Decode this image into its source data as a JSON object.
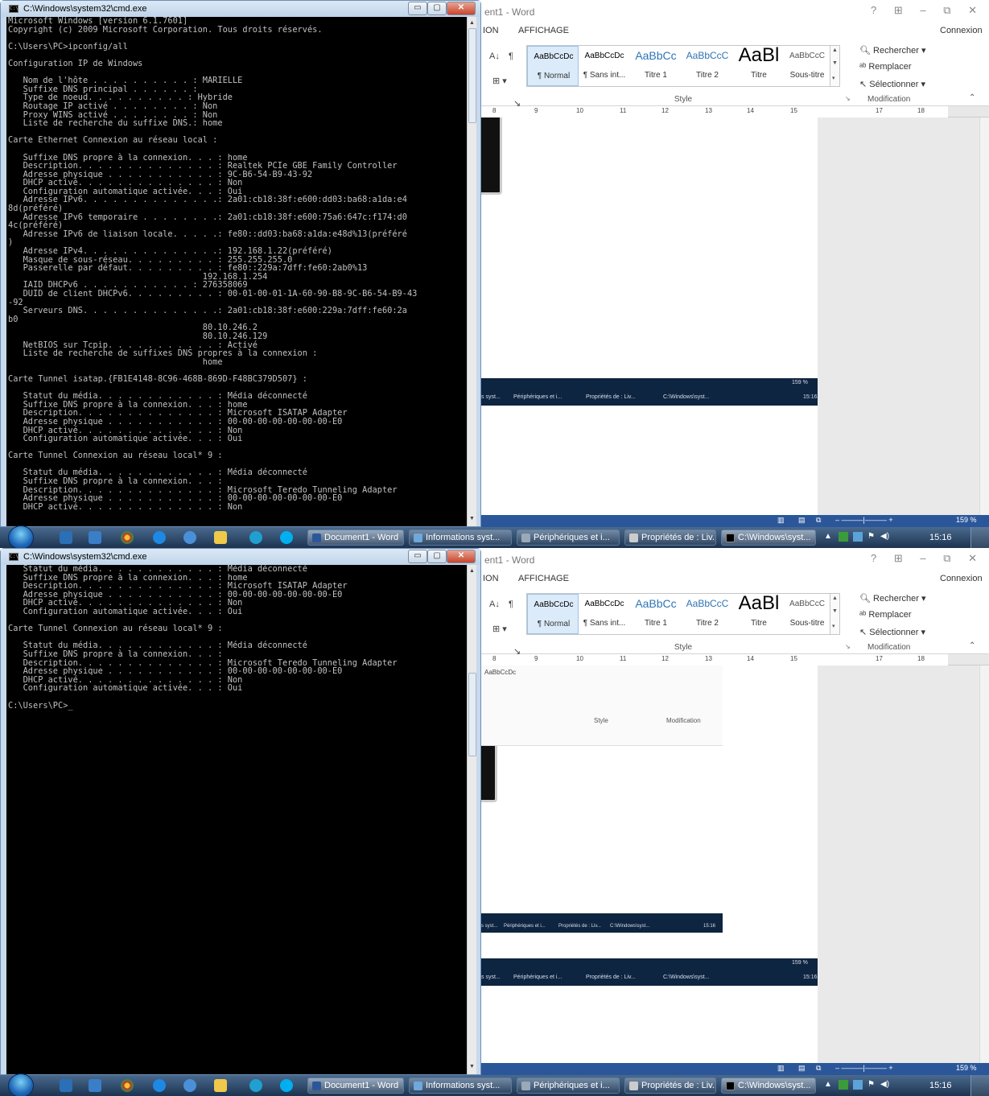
{
  "cmd": {
    "title": "C:\\Windows\\system32\\cmd.exe",
    "icon_label": "C:\\",
    "buttons": {
      "minimize": "▭",
      "maximize": "▢",
      "close": "✕"
    },
    "top_text": "Microsoft Windows [version 6.1.7601]\nCopyright (c) 2009 Microsoft Corporation. Tous droits réservés.\n\nC:\\Users\\PC>ipconfig/all\n\nConfiguration IP de Windows\n\n   Nom de l'hôte . . . . . . . . . . : MARIELLE\n   Suffixe DNS principal . . . . . . :\n   Type de noeud. . . . . . . . . . : Hybride\n   Routage IP activé . . . . . . . . : Non\n   Proxy WINS activé . . . . . . . . : Non\n   Liste de recherche du suffixe DNS.: home\n\nCarte Ethernet Connexion au réseau local :\n\n   Suffixe DNS propre à la connexion. . . : home\n   Description. . . . . . . . . . . . . . : Realtek PCIe GBE Family Controller\n   Adresse physique . . . . . . . . . . . : 9C-B6-54-B9-43-92\n   DHCP activé. . . . . . . . . . . . . . : Non\n   Configuration automatique activée. . . : Oui\n   Adresse IPv6. . . . . . . . . . . . . .: 2a01:cb18:38f:e600:dd03:ba68:a1da:e4\n8d(préféré)\n   Adresse IPv6 temporaire . . . . . . . .: 2a01:cb18:38f:e600:75a6:647c:f174:d0\n4c(préféré)\n   Adresse IPv6 de liaison locale. . . . .: fe80::dd03:ba68:a1da:e48d%13(préféré\n)\n   Adresse IPv4. . . . . . . . . . . . . .: 192.168.1.22(préféré)\n   Masque de sous-réseau. . . . . . . . . : 255.255.255.0\n   Passerelle par défaut. . . . . . . . . : fe80::229a:7dff:fe60:2ab0%13\n                                       192.168.1.254\n   IAID DHCPv6 . . . . . . . . . . . : 276358069\n   DUID de client DHCPv6. . . . . . . . . : 00-01-00-01-1A-60-90-B8-9C-B6-54-B9-43\n-92\n   Serveurs DNS. . . . . . . . . . . . . .: 2a01:cb18:38f:e600:229a:7dff:fe60:2a\nb0\n                                       80.10.246.2\n                                       80.10.246.129\n   NetBIOS sur Tcpip. . . . . . . . . . . : Activé\n   Liste de recherche de suffixes DNS propres à la connexion :\n                                       home\n\nCarte Tunnel isatap.{FB1E4148-8C96-468B-869D-F48BC379D507} :\n\n   Statut du média. . . . . . . . . . . . : Média déconnecté\n   Suffixe DNS propre à la connexion. . . : home\n   Description. . . . . . . . . . . . . . : Microsoft ISATAP Adapter\n   Adresse physique . . . . . . . . . . . : 00-00-00-00-00-00-00-E0\n   DHCP activé. . . . . . . . . . . . . . : Non\n   Configuration automatique activée. . . : Oui\n\nCarte Tunnel Connexion au réseau local* 9 :\n\n   Statut du média. . . . . . . . . . . . : Média déconnecté\n   Suffixe DNS propre à la connexion. . . :\n   Description. . . . . . . . . . . . . . : Microsoft Teredo Tunneling Adapter\n   Adresse physique . . . . . . . . . . . : 00-00-00-00-00-00-00-E0\n   DHCP activé. . . . . . . . . . . . . . : Non",
    "bottom_text": "   Statut du média. . . . . . . . . . . . : Média déconnecté\n   Suffixe DNS propre à la connexion. . . : home\n   Description. . . . . . . . . . . . . . : Microsoft ISATAP Adapter\n   Adresse physique . . . . . . . . . . . : 00-00-00-00-00-00-00-E0\n   DHCP activé. . . . . . . . . . . . . . : Non\n   Configuration automatique activée. . . : Oui\n\nCarte Tunnel Connexion au réseau local* 9 :\n\n   Statut du média. . . . . . . . . . . . : Média déconnecté\n   Suffixe DNS propre à la connexion. . . :\n   Description. . . . . . . . . . . . . . : Microsoft Teredo Tunneling Adapter\n   Adresse physique . . . . . . . . . . . : 00-00-00-00-00-00-00-E0\n   DHCP activé. . . . . . . . . . . . . . : Non\n   Configuration automatique activée. . . : Oui\n\nC:\\Users\\PC>_"
  },
  "word": {
    "title": "ent1 - Word",
    "window_controls": "? ⊞ – ⧉ ✕",
    "tabs": {
      "left": "ION",
      "view": "AFFICHAGE",
      "signin": "Connexion"
    },
    "para": {
      "sort": "A↓",
      "pilcrow": "¶",
      "borders": "⊞ ▾"
    },
    "styles": [
      {
        "preview": "AaBbCcDc",
        "name": "¶ Normal"
      },
      {
        "preview": "AaBbCcDc",
        "name": "¶ Sans int..."
      },
      {
        "preview": "AaBbCc",
        "name": "Titre 1"
      },
      {
        "preview": "AaBbCcC",
        "name": "Titre 2"
      },
      {
        "preview": "AaBl",
        "name": "Titre"
      },
      {
        "preview": "AaBbCcC",
        "name": "Sous-titre"
      }
    ],
    "style_group": "Style",
    "modification": {
      "find": "Rechercher ▾",
      "replace": "Remplacer",
      "select": "Sélectionner ▾",
      "group": "Modification"
    },
    "ruler": [
      "8",
      "9",
      "10",
      "11",
      "12",
      "13",
      "14",
      "15",
      "17",
      "18"
    ],
    "zoom": "159 %",
    "nested_taskbar": [
      "s syst...",
      "Périphériques et i...",
      "Propriétés de : Liv...",
      "C:\\Windows\\syst...",
      "15:16"
    ],
    "nested_zoom": "159 %"
  },
  "taskbar": {
    "buttons": [
      "Document1 - Word",
      "Informations syst...",
      "Périphériques et i...",
      "Propriétés de : Liv...",
      "C:\\Windows\\syst..."
    ],
    "clock": "15:16",
    "tray": {
      "up": "▲",
      "flag": "⚑",
      "speaker": "◀)"
    }
  },
  "colors": {
    "word_blue": "#2b579a",
    "taskbar": "#1c3350",
    "cmd_bg": "#000000"
  }
}
